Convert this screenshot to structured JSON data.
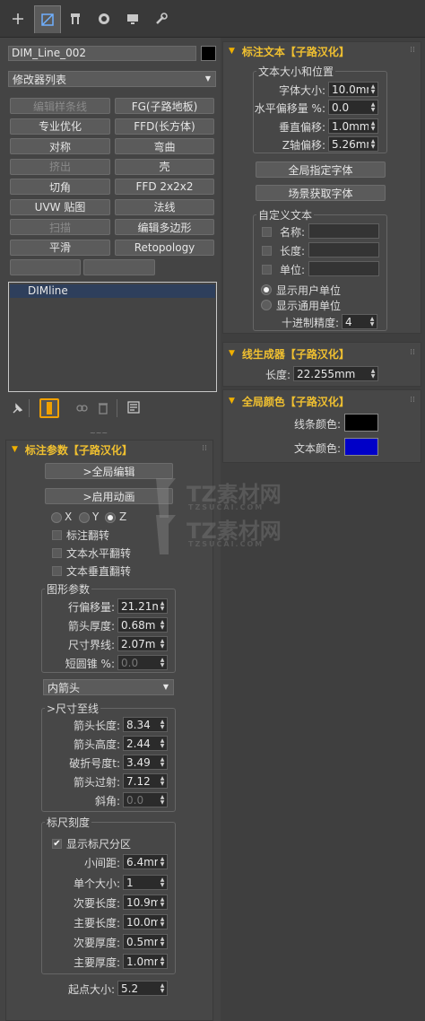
{
  "toolbar": {
    "tabs": [
      {
        "name": "create-tab",
        "glyph": "+"
      },
      {
        "name": "modify-tab",
        "glyph": ""
      },
      {
        "name": "hierarchy-tab",
        "glyph": ""
      },
      {
        "name": "motion-tab",
        "glyph": ""
      },
      {
        "name": "display-tab",
        "glyph": ""
      },
      {
        "name": "utilities-tab",
        "glyph": ""
      }
    ]
  },
  "left": {
    "object_name": "DIM_Line_002",
    "object_color": "#000000",
    "modifier_list": "修改器列表",
    "modifier_buttons": [
      [
        "编辑样条线",
        "FG(子路地板)"
      ],
      [
        "专业优化",
        "FFD(长方体)"
      ],
      [
        "对称",
        "弯曲"
      ],
      [
        "挤出",
        "壳"
      ],
      [
        "切角",
        "FFD 2x2x2"
      ],
      [
        "UVW 贴图",
        "法线"
      ],
      [
        "扫描",
        "编辑多边形"
      ],
      [
        "平滑",
        "Retopology"
      ]
    ],
    "stack_item": "DIMline"
  },
  "annot_params": {
    "title": "标注参数【子路汉化】",
    "global_edit": ">全局编辑",
    "enable_anim": ">启用动画",
    "axis_x": "X",
    "axis_y": "Y",
    "axis_z": "Z",
    "flip_annot": "标注翻转",
    "flip_text_h": "文本水平翻转",
    "flip_text_v": "文本垂直翻转",
    "shape_group": "图形参数",
    "row_offset_label": "行偏移量:",
    "row_offset": "21.21m",
    "arrow_thick_label": "箭头厚度:",
    "arrow_thick": "0.68m",
    "dim_line_label": "尺寸界线:",
    "dim_line": "2.07m",
    "short_cone_label": "短圆锥 %:",
    "short_cone": "0.0",
    "arrow_type": "内箭头",
    "ext_group": ">尺寸至线",
    "arrow_len_label": "箭头长度:",
    "arrow_len": "8.34",
    "arrow_h_label": "箭头高度:",
    "arrow_h": "2.44",
    "break_label": "破折号度t:",
    "break_val": "3.49",
    "arrow_over_label": "箭头过射:",
    "arrow_over": "7.12",
    "slope_label": "斜角:",
    "slope": "0.0",
    "scale_group": "标尺刻度",
    "show_scale": "显示标尺分区",
    "small_pitch_label": "小间距:",
    "small_pitch": "6.4mm",
    "unit_size_label": "单个大小:",
    "unit_size": "1",
    "minor_len_label": "次要长度:",
    "minor_len": "10.9m",
    "major_len_label": "主要长度:",
    "major_len": "10.0m",
    "minor_thick_label": "次要厚度:",
    "minor_thick": "0.5mm",
    "major_thick_label": "主要厚度:",
    "major_thick": "1.0mm",
    "start_size_label": "起点大小:",
    "start_size": "5.2"
  },
  "annot_text": {
    "title": "标注文本【子路汉化】",
    "group": "文本大小和位置",
    "font_size_label": "字体大小:",
    "font_size": "10.0mm",
    "h_offset_label": "水平偏移量 %:",
    "h_offset": "0.0",
    "v_offset_label": "垂直偏移:",
    "v_offset": "1.0mm",
    "z_offset_label": "Z轴偏移:",
    "z_offset": "5.26mm",
    "global_font_btn": "全局指定字体",
    "scene_font_btn": "场景获取字体",
    "custom_group": "自定义文本",
    "name_label": "名称:",
    "length_label": "长度:",
    "unit_label": "单位:",
    "show_user_unit": "显示用户单位",
    "show_general_unit": "显示通用单位",
    "decimal_label": "十进制精度:",
    "decimal": "4"
  },
  "line_gen": {
    "title": "线生成器【子路汉化】",
    "length_label": "长度:",
    "length": "22.255mm"
  },
  "global_color": {
    "title": "全局颜色【子路汉化】",
    "line_color_label": "线条颜色:",
    "line_color": "#000000",
    "text_color_label": "文本颜色:",
    "text_color": "#0000c8"
  },
  "watermark": {
    "brand": "TZ素材网",
    "url": "TZSUCAI.COM"
  }
}
